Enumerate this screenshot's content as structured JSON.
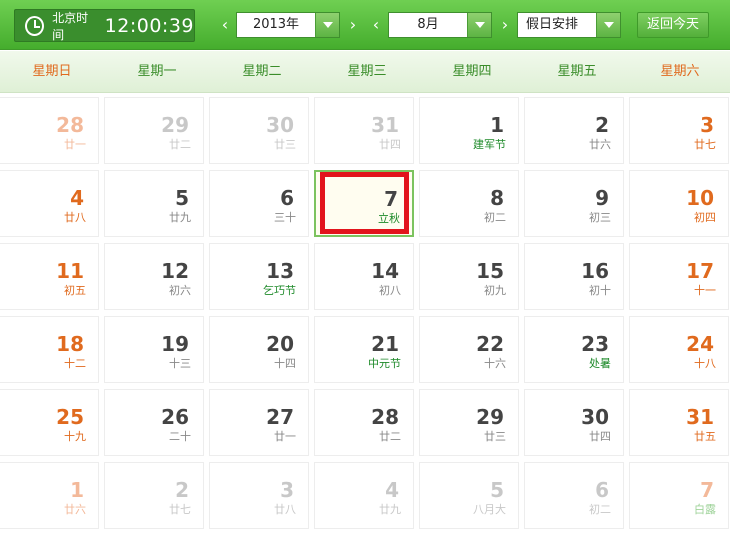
{
  "clock": {
    "label": "北京时间",
    "time": "12:00:39"
  },
  "year_select": {
    "value": "2013年"
  },
  "month_select": {
    "value": "8月"
  },
  "holiday_select": {
    "value": "假日安排"
  },
  "today_button": {
    "label": "返回今天"
  },
  "arrows": {
    "prev": "‹",
    "next": "›"
  },
  "weekdays": [
    "星期日",
    "星期一",
    "星期二",
    "星期三",
    "星期四",
    "星期五",
    "星期六"
  ],
  "colors": {
    "header": "#4fb735",
    "weekend": "#e06a1e",
    "festival": "#1e8a2a",
    "today_outline": "#e2141c"
  },
  "today": "7",
  "weeks": [
    [
      {
        "d": "28",
        "s": "廿一",
        "o": true
      },
      {
        "d": "29",
        "s": "廿二",
        "o": true
      },
      {
        "d": "30",
        "s": "廿三",
        "o": true
      },
      {
        "d": "31",
        "s": "廿四",
        "o": true
      },
      {
        "d": "1",
        "s": "建军节",
        "f": true
      },
      {
        "d": "2",
        "s": "廿六"
      },
      {
        "d": "3",
        "s": "廿七"
      }
    ],
    [
      {
        "d": "4",
        "s": "廿八"
      },
      {
        "d": "5",
        "s": "廿九"
      },
      {
        "d": "6",
        "s": "三十"
      },
      {
        "d": "7",
        "s": "立秋",
        "f": true,
        "t": true
      },
      {
        "d": "8",
        "s": "初二"
      },
      {
        "d": "9",
        "s": "初三"
      },
      {
        "d": "10",
        "s": "初四"
      }
    ],
    [
      {
        "d": "11",
        "s": "初五"
      },
      {
        "d": "12",
        "s": "初六"
      },
      {
        "d": "13",
        "s": "乞巧节",
        "f": true
      },
      {
        "d": "14",
        "s": "初八"
      },
      {
        "d": "15",
        "s": "初九"
      },
      {
        "d": "16",
        "s": "初十"
      },
      {
        "d": "17",
        "s": "十一"
      }
    ],
    [
      {
        "d": "18",
        "s": "十二"
      },
      {
        "d": "19",
        "s": "十三"
      },
      {
        "d": "20",
        "s": "十四"
      },
      {
        "d": "21",
        "s": "中元节",
        "f": true
      },
      {
        "d": "22",
        "s": "十六"
      },
      {
        "d": "23",
        "s": "处暑",
        "f": true
      },
      {
        "d": "24",
        "s": "十八"
      }
    ],
    [
      {
        "d": "25",
        "s": "十九"
      },
      {
        "d": "26",
        "s": "二十"
      },
      {
        "d": "27",
        "s": "廿一"
      },
      {
        "d": "28",
        "s": "廿二"
      },
      {
        "d": "29",
        "s": "廿三"
      },
      {
        "d": "30",
        "s": "廿四"
      },
      {
        "d": "31",
        "s": "廿五"
      }
    ],
    [
      {
        "d": "1",
        "s": "廿六",
        "o": true
      },
      {
        "d": "2",
        "s": "廿七",
        "o": true
      },
      {
        "d": "3",
        "s": "廿八",
        "o": true
      },
      {
        "d": "4",
        "s": "廿九",
        "o": true
      },
      {
        "d": "5",
        "s": "八月大",
        "o": true
      },
      {
        "d": "6",
        "s": "初二",
        "o": true
      },
      {
        "d": "7",
        "s": "白露",
        "o": true,
        "f": true
      }
    ]
  ]
}
